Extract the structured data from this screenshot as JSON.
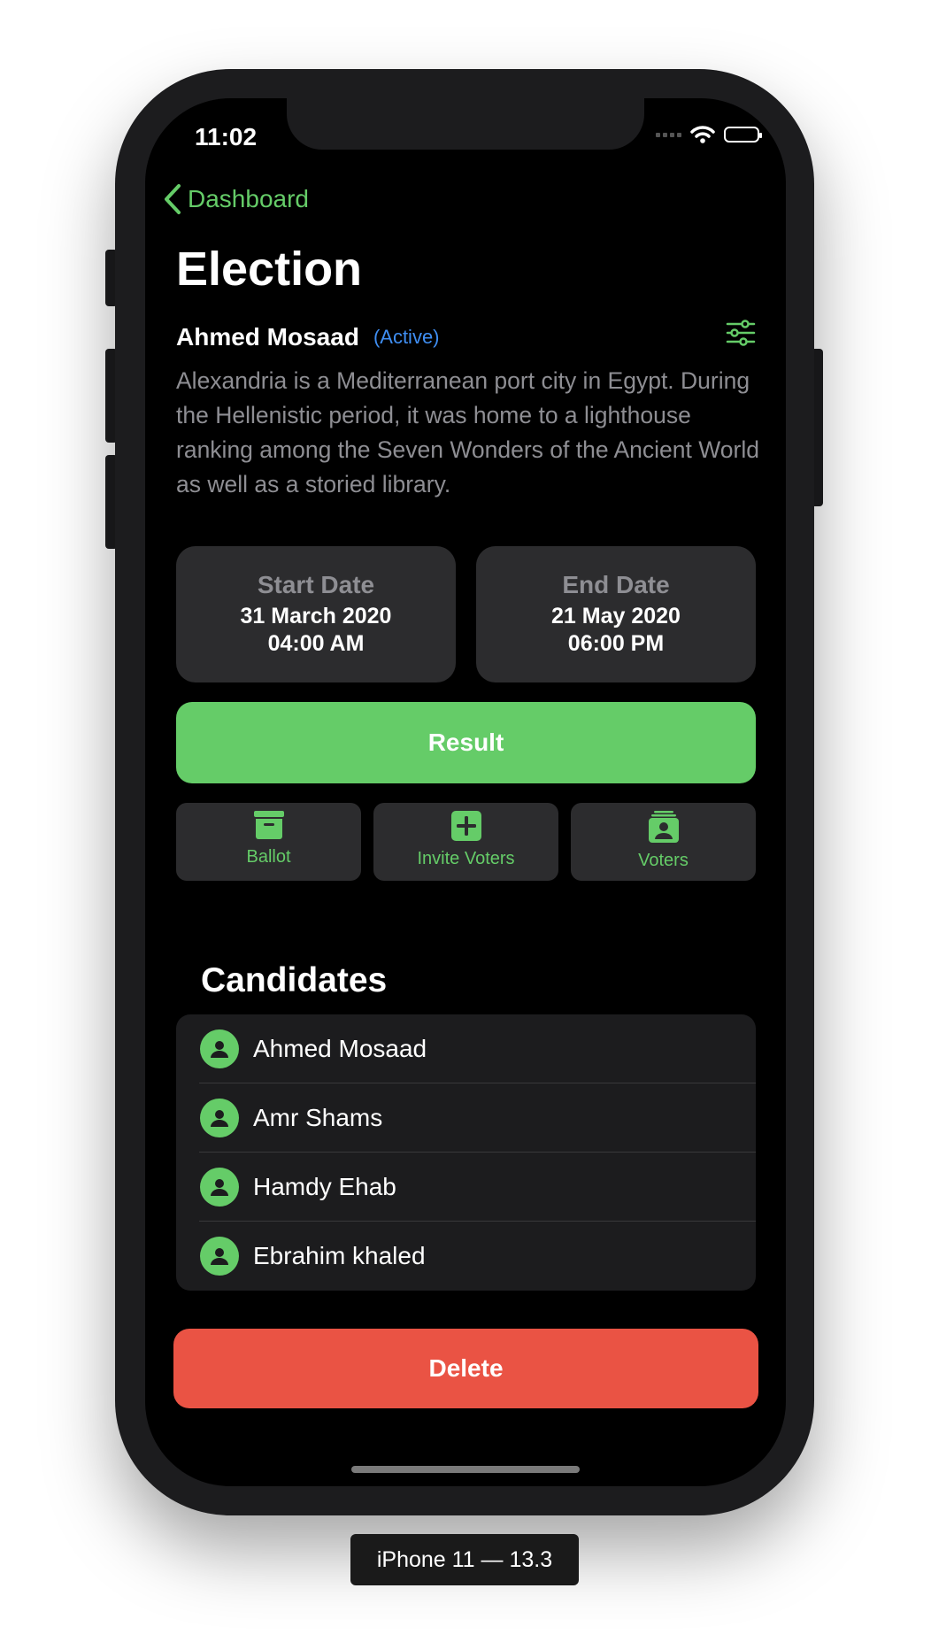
{
  "status_bar": {
    "time": "11:02"
  },
  "nav": {
    "back_label": "Dashboard"
  },
  "page": {
    "title": "Election",
    "owner": "Ahmed Mosaad",
    "status": "(Active)",
    "description": "Alexandria is a Mediterranean port city in Egypt. During the Hellenistic period, it was home to a lighthouse ranking among the Seven Wonders of the Ancient World as well as a storied library."
  },
  "dates": {
    "start": {
      "label": "Start Date",
      "date": "31 March 2020",
      "time": "04:00 AM"
    },
    "end": {
      "label": "End Date",
      "date": "21 May 2020",
      "time": "06:00 PM"
    }
  },
  "result_button": "Result",
  "actions": [
    {
      "label": "Ballot",
      "icon": "archive-box-icon"
    },
    {
      "label": "Invite Voters",
      "icon": "plus-square-icon"
    },
    {
      "label": "Voters",
      "icon": "person-stack-icon"
    }
  ],
  "candidates": {
    "title": "Candidates",
    "items": [
      "Ahmed Mosaad",
      "Amr Shams",
      "Hamdy Ehab",
      "Ebrahim khaled"
    ]
  },
  "delete_button": "Delete",
  "device_label": "iPhone 11 — 13.3",
  "colors": {
    "accent": "#65cc68",
    "destructive": "#ea5344",
    "active": "#3f8ef2",
    "card": "#2c2c2e"
  }
}
